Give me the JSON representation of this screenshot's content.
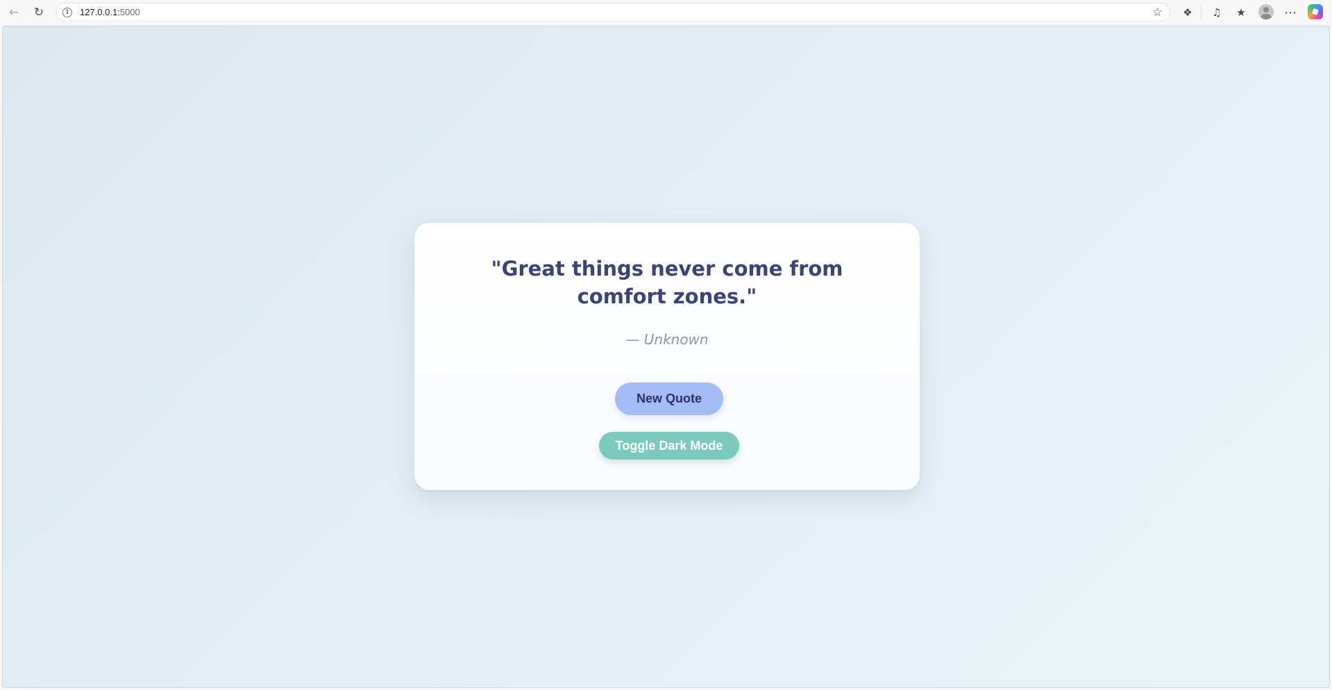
{
  "browser": {
    "url_host": "127.0.0.1:",
    "url_port": "5000"
  },
  "page": {
    "quote": "\"Great things never come from comfort zones.\"",
    "author": "— Unknown",
    "new_quote_label": "New Quote",
    "toggle_dark_label": "Toggle Dark Mode"
  },
  "colors": {
    "quote_text": "#3d4372",
    "new_quote_button": "#a5bcf6",
    "toggle_button": "#7ccabd"
  }
}
